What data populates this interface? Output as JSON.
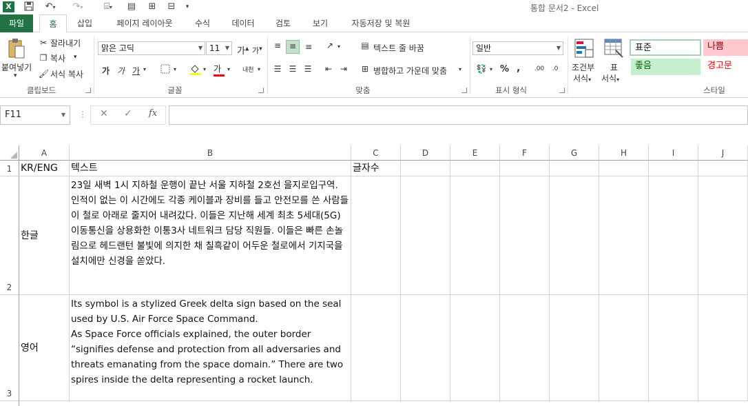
{
  "window": {
    "title": "통합 문서2 - Excel",
    "app_icon": "X"
  },
  "quick_access": [
    "save-icon",
    "undo-icon",
    "redo-icon",
    "format-painter-icon",
    "form-icon",
    "view-icon",
    "customize-icon"
  ],
  "tabs": [
    {
      "label": "파일"
    },
    {
      "label": "홈"
    },
    {
      "label": "삽입"
    },
    {
      "label": "페이지 레이아웃"
    },
    {
      "label": "수식"
    },
    {
      "label": "데이터"
    },
    {
      "label": "검토"
    },
    {
      "label": "보기"
    },
    {
      "label": "자동저장 및 복원"
    }
  ],
  "ribbon": {
    "clipboard": {
      "paste": "붙여넣기",
      "cut": "잘라내기",
      "copy": "복사",
      "format_painter": "서식 복사",
      "label": "클립보드"
    },
    "font": {
      "font_name": "맑은 고딕",
      "font_size": "11",
      "grow": "가",
      "shrink": "가",
      "bold": "가",
      "italic": "가",
      "underline": "가",
      "font_color_glyph": "가",
      "phonetic": "내천",
      "label": "글꼴"
    },
    "alignment": {
      "wrap_text": "텍스트 줄 바꿈",
      "merge_center": "병합하고 가운데 맞춤",
      "label": "맞춤"
    },
    "number": {
      "format": "일반",
      "percent": "%",
      "comma": ",",
      "label": "표시 형식"
    },
    "styles": {
      "conditional_1": "조건부",
      "conditional_2": "서식",
      "table_1": "표",
      "table_2": "서식",
      "normal": "표준",
      "bad": "나쁨",
      "good": "좋음",
      "warning": "경고문",
      "label": "스타일",
      "colors": {
        "normal_bg": "#ffffff",
        "bad_bg": "#ffc7ce",
        "bad_fg": "#9c0006",
        "good_bg": "#c6efce",
        "good_fg": "#006100",
        "warning_fg": "#ff0000"
      }
    }
  },
  "formula_bar": {
    "name_box": "F11",
    "cancel": "✕",
    "enter": "✓",
    "fx": "fx",
    "value": ""
  },
  "grid": {
    "columns": [
      "A",
      "B",
      "C",
      "D",
      "E",
      "F",
      "G",
      "H",
      "I",
      "J"
    ],
    "rows": [
      {
        "num": "1",
        "a": "KR/ENG",
        "b": "텍스트",
        "c": "글자수"
      },
      {
        "num": "2",
        "a": "한글",
        "b": "23일 새벽 1시 지하철 운행이 끝난 서울 지하철 2호선 을지로입구역. 인적이 없는 이 시간에도 각종 케이블과 장비를 들고 안전모를 쓴 사람들이 철로 아래로 줄지어 내려갔다. 이들은 지난해 세계 최초 5세대(5G) 이동통신을 상용화한 이통3사 네트워크 담당 직원들. 이들은 빠른 손놀림으로 헤드랜턴 불빛에 의지한 채 칠흑같이 어두운 철로에서 기지국을 설치에만 신경을 쏟았다.",
        "c": ""
      },
      {
        "num": "3",
        "a": "영어",
        "b": "Its symbol is a stylized Greek delta sign based on the seal used by U.S. Air Force Space Command.\nAs Space Force officials explained, the outer border “signifies defense and protection from all adversaries and threats emanating from the space domain.” There are two spires inside the delta representing a rocket launch.",
        "c": ""
      }
    ],
    "accent": "#217346"
  }
}
